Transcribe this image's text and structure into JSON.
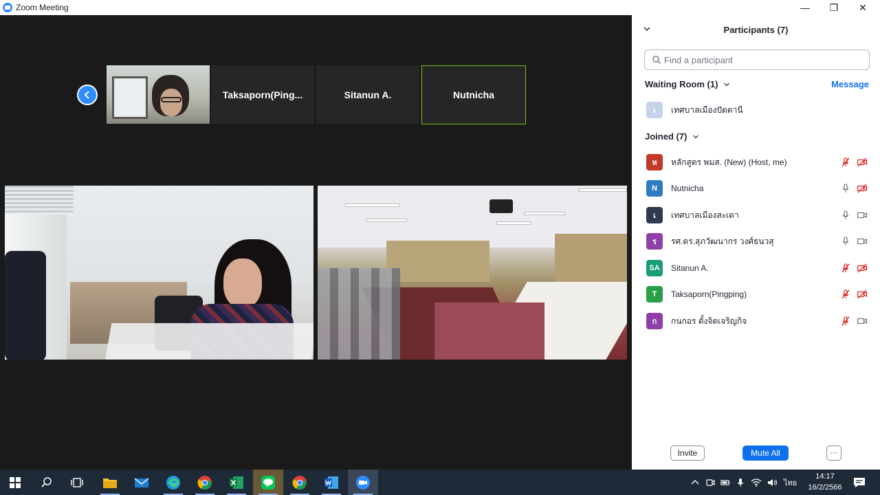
{
  "window": {
    "title": "Zoom Meeting",
    "minimize_glyph": "—",
    "restore_glyph": "❐",
    "close_glyph": "✕"
  },
  "video_strip": {
    "thumbnails": [
      {
        "name": "",
        "has_video": true
      },
      {
        "name": "Taksaporn(Ping..."
      },
      {
        "name": "Sitanun A."
      },
      {
        "name": "Nutnicha",
        "active": true
      }
    ]
  },
  "participants_panel": {
    "title": "Participants (7)",
    "search_placeholder": "Find a participant",
    "waiting_room": {
      "label": "Waiting Room (1)",
      "message_link": "Message",
      "people": [
        {
          "initial": "เ",
          "name": "เทศบาลเมืองปัตตานี",
          "color": "#c5d3e8"
        }
      ]
    },
    "joined": {
      "label": "Joined (7)",
      "people": [
        {
          "initial": "ห",
          "name": "หลักสูตร พมส. (New) (Host, me)",
          "color": "#c0392b",
          "mic": "muted",
          "video": "off"
        },
        {
          "initial": "N",
          "name": "Nutnicha",
          "color": "#2f7bbf",
          "mic": "on",
          "video": "off"
        },
        {
          "initial": "เ",
          "name": "เทศบาลเมืองสะเดา",
          "color": "#2d3a4f",
          "mic": "on",
          "video": "on"
        },
        {
          "initial": "ร",
          "name": "รศ.ดร.สุภวัฒนากร วงศ์ธนวสุ",
          "color": "#8e3fa8",
          "mic": "on",
          "video": "on"
        },
        {
          "initial": "SA",
          "name": "Sitanun A.",
          "color": "#1a9c78",
          "mic": "muted",
          "video": "off"
        },
        {
          "initial": "T",
          "name": "Taksaporn(Pingping)",
          "color": "#27a046",
          "mic": "muted",
          "video": "off"
        },
        {
          "initial": "ก",
          "name": "กนกอร ตั้งจิตเจริญกิจ",
          "color": "#8e3fa8",
          "mic": "muted",
          "video": "on"
        }
      ]
    },
    "footer": {
      "invite_label": "Invite",
      "mute_all_label": "Mute All",
      "more_label": "···"
    }
  },
  "taskbar": {
    "apps": [
      "start-icon",
      "search-icon",
      "task-view-icon",
      "file-explorer-icon",
      "mail-icon",
      "edge-icon",
      "chrome-icon",
      "excel-icon",
      "line-icon",
      "chrome-icon",
      "word-icon",
      "zoom-icon"
    ],
    "language": "ไทย",
    "time": "14:17",
    "date": "16/2/2566"
  },
  "colors": {
    "accent": "#0e71eb",
    "zoom_blue": "#2d8cff",
    "muted_red": "#e02828",
    "active_border": "#7cc21b"
  }
}
